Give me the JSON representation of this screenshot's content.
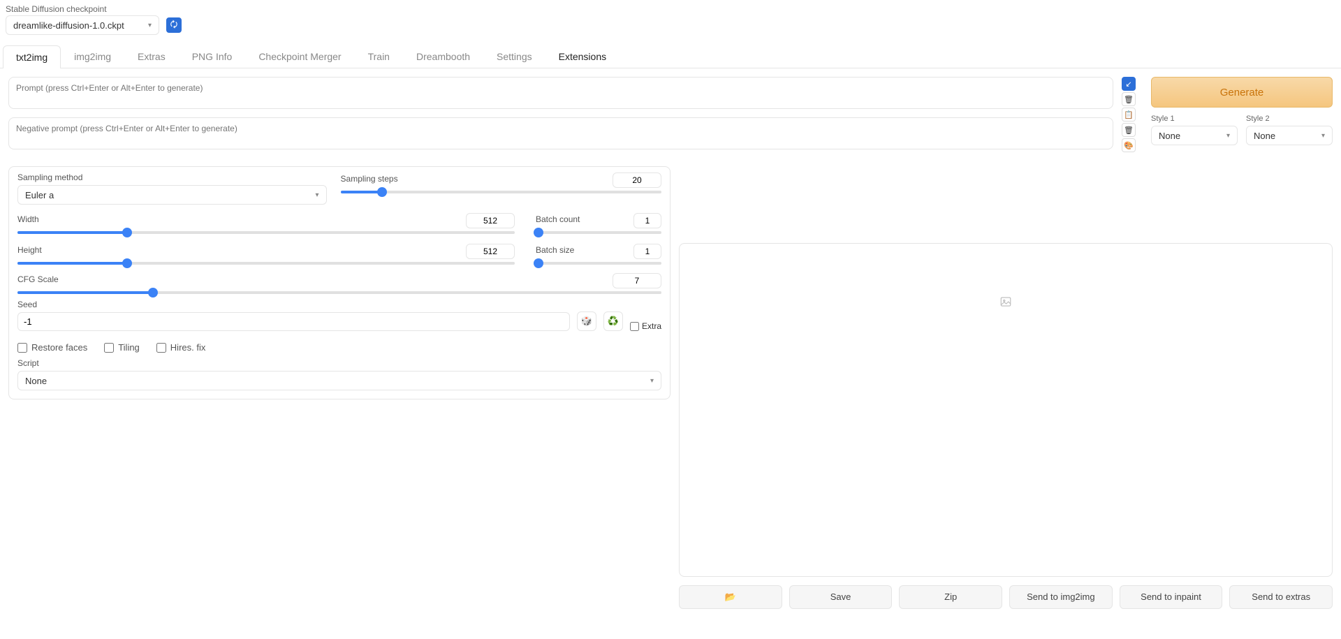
{
  "header": {
    "checkpoint_label": "Stable Diffusion checkpoint",
    "checkpoint_value": "dreamlike-diffusion-1.0.ckpt"
  },
  "tabs": [
    "txt2img",
    "img2img",
    "Extras",
    "PNG Info",
    "Checkpoint Merger",
    "Train",
    "Dreambooth",
    "Settings",
    "Extensions"
  ],
  "prompt": {
    "placeholder": "Prompt (press Ctrl+Enter or Alt+Enter to generate)",
    "neg_placeholder": "Negative prompt (press Ctrl+Enter or Alt+Enter to generate)"
  },
  "generate_label": "Generate",
  "style": {
    "label1": "Style 1",
    "label2": "Style 2",
    "value1": "None",
    "value2": "None"
  },
  "panel": {
    "sampling_method_label": "Sampling method",
    "sampling_method_value": "Euler a",
    "sampling_steps_label": "Sampling steps",
    "sampling_steps_value": "20",
    "width_label": "Width",
    "width_value": "512",
    "height_label": "Height",
    "height_value": "512",
    "batch_count_label": "Batch count",
    "batch_count_value": "1",
    "batch_size_label": "Batch size",
    "batch_size_value": "1",
    "cfg_label": "CFG Scale",
    "cfg_value": "7",
    "seed_label": "Seed",
    "seed_value": "-1",
    "extra_label": "Extra",
    "restore_faces": "Restore faces",
    "tiling": "Tiling",
    "hires_fix": "Hires. fix",
    "script_label": "Script",
    "script_value": "None"
  },
  "buttons": {
    "folder": "📂",
    "save": "Save",
    "zip": "Zip",
    "send_img2img": "Send to img2img",
    "send_inpaint": "Send to inpaint",
    "send_extras": "Send to extras"
  },
  "sliders": {
    "steps_pct": 13,
    "width_pct": 22,
    "height_pct": 22,
    "batch_count_pct": 2,
    "batch_size_pct": 2,
    "cfg_pct": 21
  }
}
